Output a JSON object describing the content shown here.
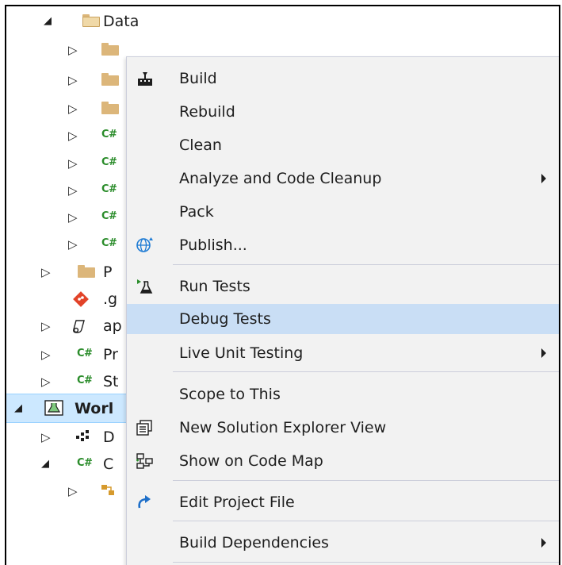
{
  "tree": {
    "data_folder_label": "Data",
    "items": [
      {
        "label": ""
      },
      {
        "label": ""
      },
      {
        "label": ""
      },
      {
        "label": "",
        "icon": "C#"
      },
      {
        "label": "",
        "icon": "C#"
      },
      {
        "label": "",
        "icon": "C#"
      },
      {
        "label": "",
        "icon": "C#"
      },
      {
        "label": "",
        "icon": "C#"
      },
      {
        "label": "P"
      },
      {
        "label": ".g"
      },
      {
        "label": "ap"
      },
      {
        "label": "Pr",
        "icon": "C#"
      },
      {
        "label": "St",
        "icon": "C#"
      },
      {
        "label": "Worl"
      },
      {
        "label": "D"
      },
      {
        "label": "C",
        "icon": "C#"
      },
      {
        "label": ""
      }
    ]
  },
  "menu": {
    "build": "Build",
    "rebuild": "Rebuild",
    "clean": "Clean",
    "analyze": "Analyze and Code Cleanup",
    "pack": "Pack",
    "publish": "Publish...",
    "run_tests": "Run Tests",
    "debug_tests": "Debug Tests",
    "live_unit_testing": "Live Unit Testing",
    "scope_to_this": "Scope to This",
    "new_solution_explorer_view": "New Solution Explorer View",
    "show_on_code_map": "Show on Code Map",
    "edit_project_file": "Edit Project File",
    "build_dependencies": "Build Dependencies"
  },
  "icons": {
    "build": "build-icon",
    "publish": "publish-globe-icon",
    "run_tests": "run-tests-flask-icon",
    "new_view": "solution-explorer-view-icon",
    "code_map": "code-map-icon",
    "edit_project": "edit-refresh-arrow-icon"
  },
  "colors": {
    "highlight": "#c9def5",
    "selected_row": "#cce8ff",
    "menu_background": "#f2f2f2",
    "csharp_green": "#2a8c2a",
    "folder": "#dcb67a"
  }
}
